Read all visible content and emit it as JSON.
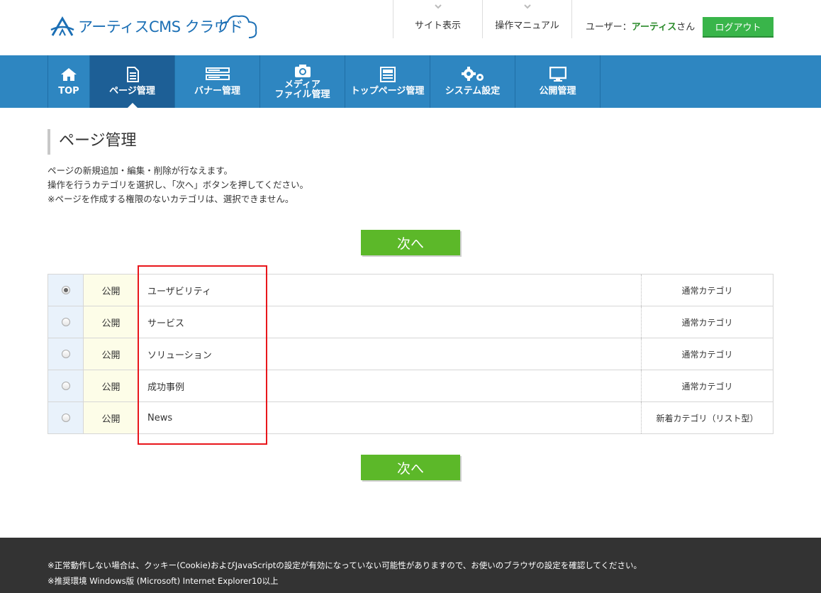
{
  "logo": {
    "text": "アーティスCMS クラウド"
  },
  "header": {
    "site_view": "サイト表示",
    "manual": "操作マニュアル",
    "user_prefix": "ユーザー：",
    "user_name": "アーティス",
    "user_suffix": "さん",
    "logout": "ログアウト"
  },
  "nav": {
    "items": [
      {
        "label": "TOP",
        "icon": "home-icon"
      },
      {
        "label": "ページ管理",
        "icon": "document-icon"
      },
      {
        "label": "バナー管理",
        "icon": "banner-icon"
      },
      {
        "label_line1": "メディア",
        "label_line2": "ファイル管理",
        "icon": "camera-icon"
      },
      {
        "label": "トップページ管理",
        "icon": "layout-icon"
      },
      {
        "label": "システム設定",
        "icon": "gears-icon"
      },
      {
        "label": "公開管理",
        "icon": "monitor-icon"
      }
    ],
    "active_index": 1
  },
  "page": {
    "title": "ページ管理",
    "desc_line1": "ページの新規追加・編集・削除が行なえます。",
    "desc_line2": "操作を行うカテゴリを選択し、「次へ」ボタンを押してください。",
    "desc_line3": "※ページを作成する権限のないカテゴリは、選択できません。",
    "next_top": "次へ",
    "next_bottom": "次へ"
  },
  "categories": [
    {
      "status": "公開",
      "name": "ユーザビリティ",
      "type": "通常カテゴリ",
      "selected": true
    },
    {
      "status": "公開",
      "name": "サービス",
      "type": "通常カテゴリ",
      "selected": false
    },
    {
      "status": "公開",
      "name": "ソリューション",
      "type": "通常カテゴリ",
      "selected": false
    },
    {
      "status": "公開",
      "name": "成功事例",
      "type": "通常カテゴリ",
      "selected": false
    },
    {
      "status": "公開",
      "name": "News",
      "type": "新着カテゴリ（リスト型）",
      "selected": false
    }
  ],
  "footer": {
    "line1": "※正常動作しない場合は、クッキー(Cookie)およびJavaScriptの設定が有効になっていない可能性がありますので、お使いのブラウザの設定を確認してください。",
    "line2": "※推奨環境 Windows版 (Microsoft) Internet Explorer10以上"
  },
  "colors": {
    "nav_bg": "#2e86c1",
    "nav_active": "#1d5f96",
    "button_green": "#5cb829",
    "logout_green": "#39b54a",
    "highlight_red": "#e8161b",
    "footer_bg": "#333333"
  }
}
